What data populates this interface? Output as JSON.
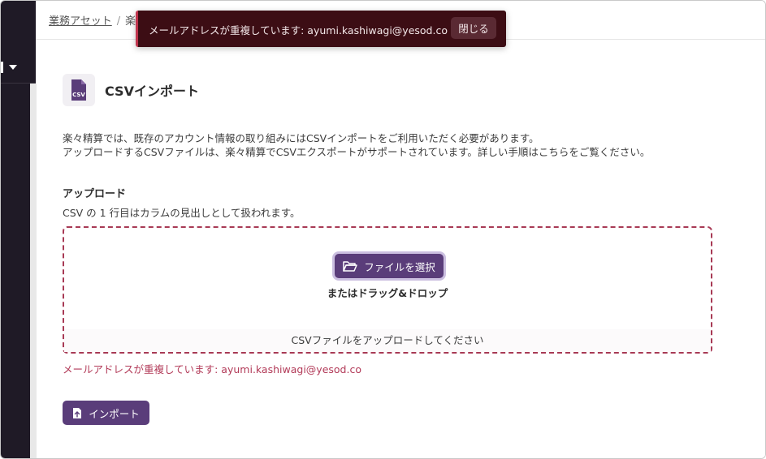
{
  "breadcrumb": {
    "link_label": "業務アセット",
    "separator": "/",
    "current_partial": "楽"
  },
  "page": {
    "title": "CSVインポート",
    "file_icon_label": "CSV",
    "description_line1": "楽々精算では、既存のアカウント情報の取り組みにはCSVインポートをご利用いただく必要があります。",
    "description_line2": "アップロードするCSVファイルは、楽々精算でCSVエクスポートがサポートされています。詳しい手順はこちらをご覧ください。"
  },
  "upload": {
    "label": "アップロード",
    "hint": "CSV の 1 行目はカラムの見出しとして扱われます。",
    "select_button": "ファイルを選択",
    "drag_text": "またはドラッグ&ドロップ",
    "footer_text": "CSVファイルをアップロードしてください",
    "error_text": "メールアドレスが重複しています: ayumi.kashiwagi@yesod.co"
  },
  "import_button": "インポート",
  "toast": {
    "message": "メールアドレスが重複しています: ayumi.kashiwagi@yesod.co",
    "close_label": "閉じる"
  },
  "colors": {
    "primary": "#5a3d7a",
    "error": "#b23a58",
    "toast_bg": "#3c0d14",
    "sidebar_bg": "#1f1a26"
  },
  "icons": {
    "file_icon": "csv-file-icon",
    "folder_icon": "folder-open-icon",
    "upload_icon": "file-upload-icon",
    "caret_icon": "caret-down-icon"
  }
}
